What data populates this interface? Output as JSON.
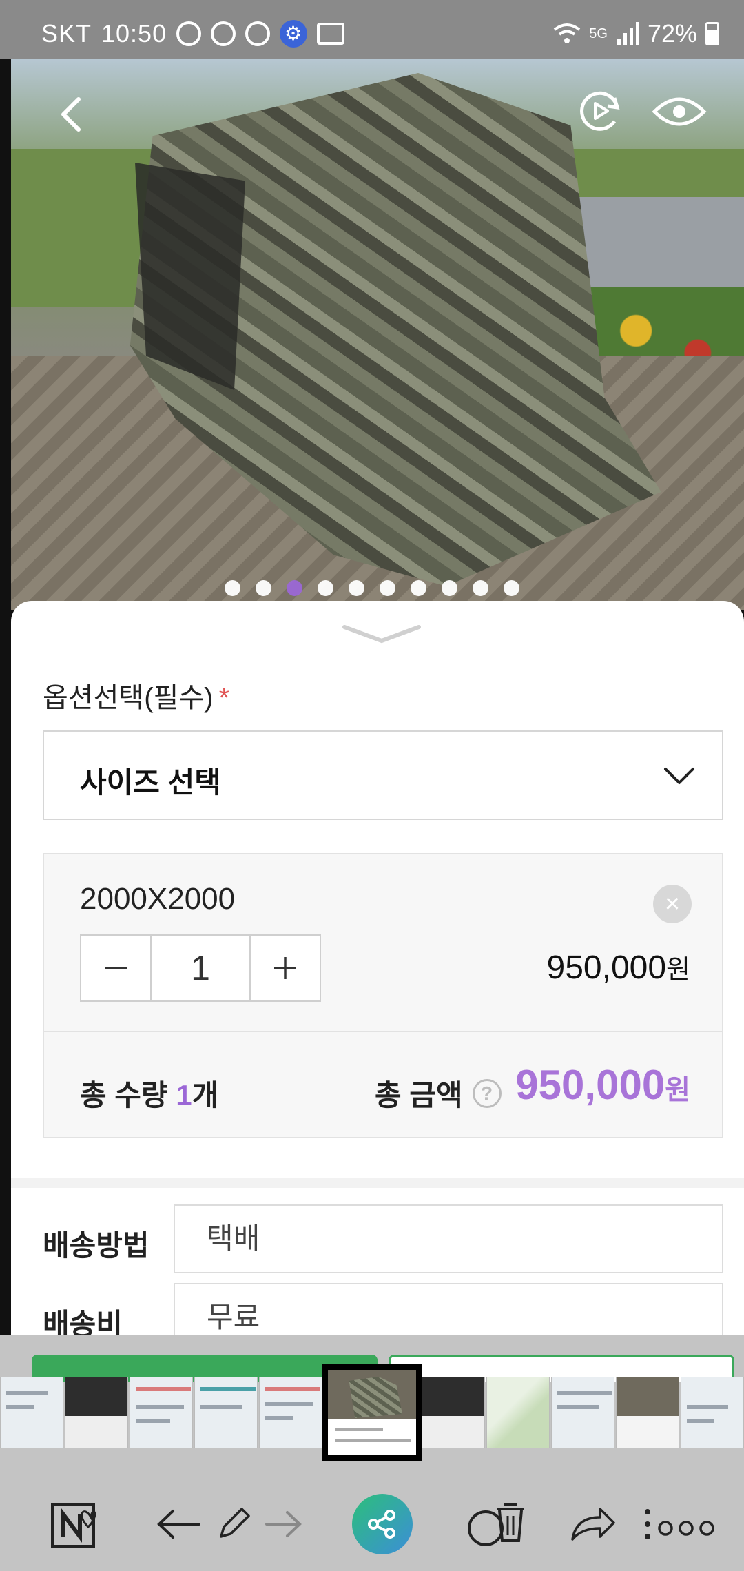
{
  "status_bar": {
    "carrier": "SKT",
    "time": "10:50",
    "network": "5G",
    "battery": "72%"
  },
  "gallery": {
    "total_images": 10,
    "active_index": 2
  },
  "option": {
    "title": "옵션선택(필수)",
    "required_mark": "*",
    "select_placeholder": "사이즈 선택",
    "selected_item": {
      "name": "2000X2000",
      "quantity": "1",
      "price": "950,000",
      "currency": "원"
    }
  },
  "totals": {
    "qty_label": "총 수량",
    "qty_value": "1",
    "qty_unit": "개",
    "amount_label": "총 금액",
    "help": "?",
    "amount_value": "950,000",
    "currency": "원"
  },
  "shipping": {
    "method_label": "배송방법",
    "method_value": "택배",
    "fee_label": "배송비",
    "fee_value": "무료"
  },
  "colors": {
    "accent": "#a874d8",
    "buy_green": "#3aa85a",
    "required": "#e05252"
  }
}
